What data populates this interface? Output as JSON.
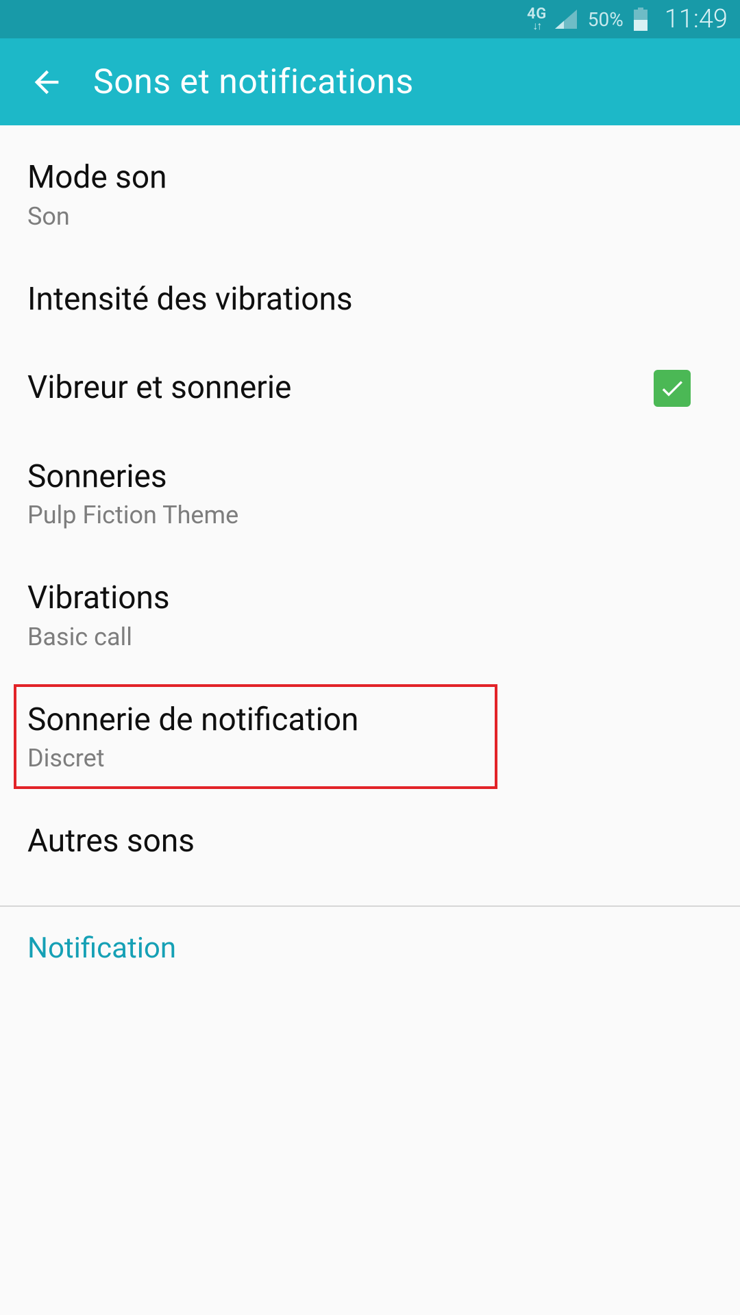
{
  "status_bar": {
    "network_label": "4G",
    "battery_text": "50%",
    "clock": "11:49"
  },
  "app_bar": {
    "title": "Sons et notifications"
  },
  "items": [
    {
      "title": "Mode son",
      "subtitle": "Son"
    },
    {
      "title": "Intensité des vibrations"
    },
    {
      "title": "Vibreur et sonnerie",
      "checked": true
    },
    {
      "title": "Sonneries",
      "subtitle": "Pulp Fiction Theme"
    },
    {
      "title": "Vibrations",
      "subtitle": "Basic call"
    },
    {
      "title": "Sonnerie de notification",
      "subtitle": "Discret",
      "highlighted": true
    },
    {
      "title": "Autres sons"
    }
  ],
  "section_header": "Notification",
  "colors": {
    "status_bar": "#189aa8",
    "app_bar": "#1db8c8",
    "accent": "#15a0b5",
    "checkbox": "#4bb855",
    "highlight_border": "#e22328"
  }
}
